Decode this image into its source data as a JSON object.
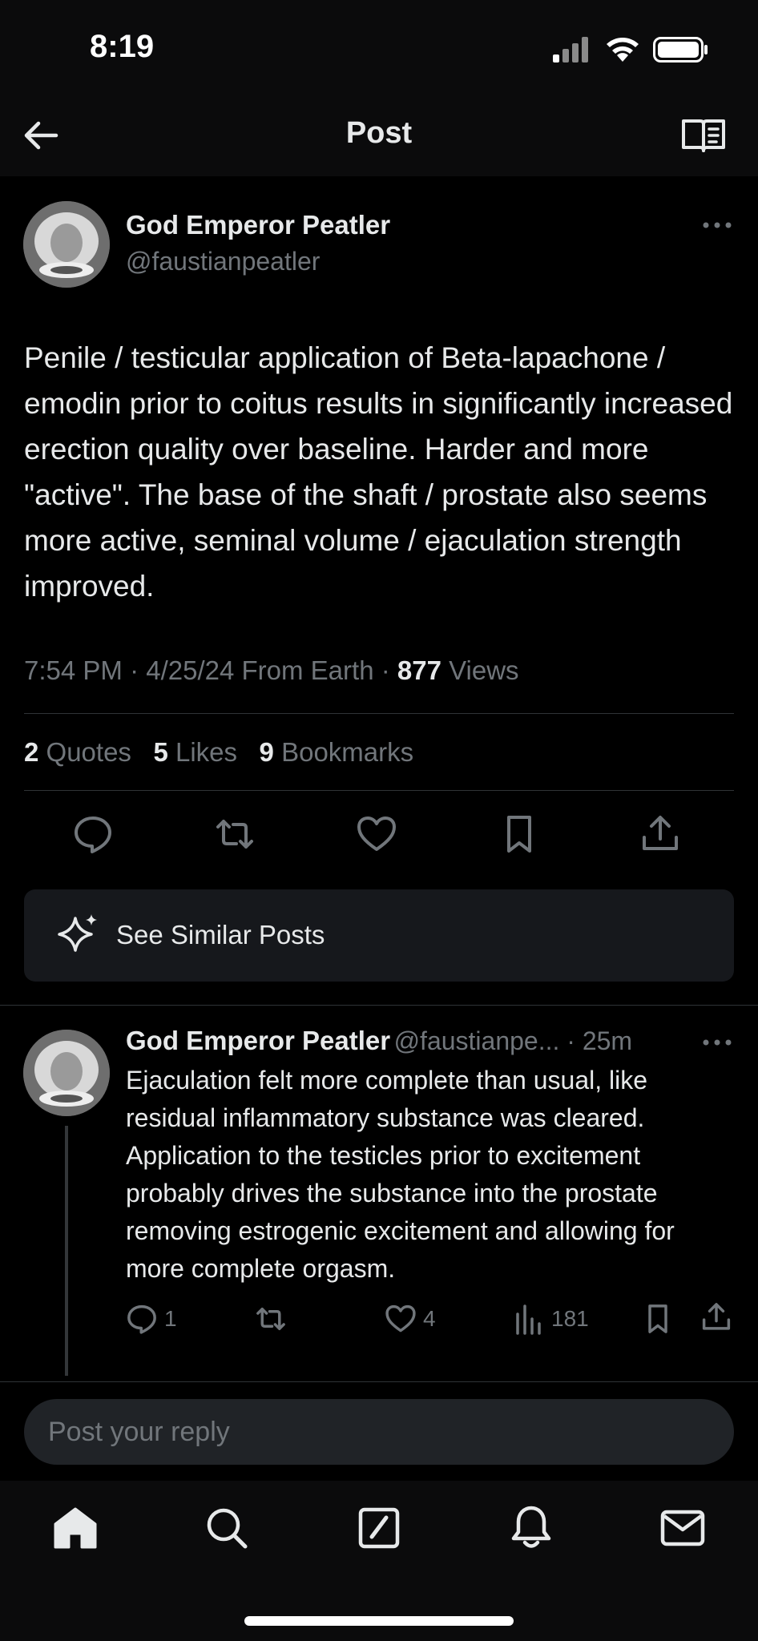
{
  "status_bar": {
    "time": "8:19"
  },
  "header": {
    "title": "Post"
  },
  "post": {
    "author_name": "God Emperor Peatler",
    "author_handle": "@faustianpeatler",
    "text": "Penile / testicular application of Beta-lapachone / emodin prior to coitus results in significantly increased erection quality over baseline. Harder and more \"active\". The base of the shaft / prostate also seems more active, seminal volume / ejaculation strength improved.",
    "time": "7:54 PM",
    "date": "4/25/24",
    "from": "From Earth",
    "views_count": "877",
    "views_label": "Views",
    "quotes_count": "2",
    "quotes_label": "Quotes",
    "likes_count": "5",
    "likes_label": "Likes",
    "bookmarks_count": "9",
    "bookmarks_label": "Bookmarks"
  },
  "similar_posts": {
    "label": "See Similar Posts"
  },
  "reply": {
    "author_name": "God Emperor Peatler",
    "author_handle": "@faustianpe...",
    "age": "25m",
    "text": "Ejaculation felt more complete than usual, like residual inflammatory substance was cleared. Application to the testicles prior to excitement probably drives the substance into the prostate removing estrogenic excitement and allowing for more complete orgasm.",
    "replies": "1",
    "likes": "4",
    "views": "181"
  },
  "composer": {
    "placeholder": "Post your reply"
  },
  "tabs": [
    "home-icon",
    "search-icon",
    "compose-icon",
    "notifications-icon",
    "messages-icon"
  ]
}
